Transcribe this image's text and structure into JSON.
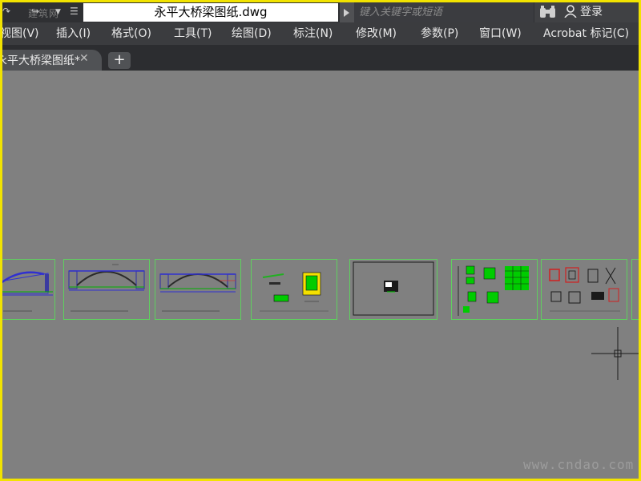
{
  "window": {
    "document_title": "永平大桥梁图纸.dwg",
    "search_placeholder": "键入关键字或短语",
    "login_label": "登录",
    "quick_access_ghost_text": "建筑网"
  },
  "menu": {
    "items": [
      {
        "label": "视图(V)"
      },
      {
        "label": "插入(I)"
      },
      {
        "label": "格式(O)"
      },
      {
        "label": "工具(T)"
      },
      {
        "label": "绘图(D)"
      },
      {
        "label": "标注(N)"
      },
      {
        "label": "修改(M)"
      },
      {
        "label": "参数(P)"
      },
      {
        "label": "窗口(W)"
      },
      {
        "label": "Acrobat 标记(C)"
      }
    ]
  },
  "tabs": {
    "active_label": "永平大桥梁图纸*",
    "add_label": "+"
  },
  "canvas": {
    "watermark": "www.cndao.com",
    "layout_thumbnails": [
      {
        "content": "bridge-arch-elevation"
      },
      {
        "content": "bridge-arch-elevation"
      },
      {
        "content": "bridge-arch-elevation"
      },
      {
        "content": "component-detail"
      },
      {
        "content": "site-plan"
      },
      {
        "content": "section-details"
      },
      {
        "content": "reinforcement-details"
      }
    ]
  },
  "colors": {
    "highlight_border": "#f2e300",
    "drawing_background": "#808080",
    "thumbnail_border": "#5fd05f"
  }
}
